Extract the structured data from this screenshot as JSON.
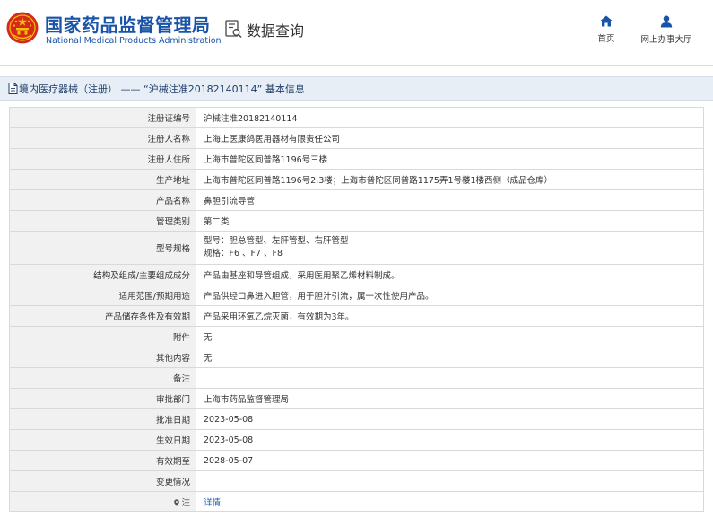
{
  "header": {
    "agency_cn": "国家药品监督管理局",
    "agency_en": "National Medical Products Administration",
    "query_title": "数据查询",
    "nav": [
      {
        "label": "首页",
        "icon": "home-icon"
      },
      {
        "label": "网上办事大厅",
        "icon": "user-icon"
      }
    ]
  },
  "title_bar": {
    "text": "境内医疗器械（注册） —— “沪械注准20182140114” 基本信息",
    "icon": "document-icon"
  },
  "record": {
    "reg_no": {
      "label": "注册证编号",
      "value": "沪械注准20182140114"
    },
    "registrant": {
      "label": "注册人名称",
      "value": "上海上医康鸽医用器材有限责任公司"
    },
    "address": {
      "label": "注册人住所",
      "value": "上海市普陀区同普路1196号三楼"
    },
    "production_address": {
      "label": "生产地址",
      "value": "上海市普陀区同普路1196号2,3楼；上海市普陀区同普路1175弄1号楼1楼西侧（成品仓库）"
    },
    "product_name": {
      "label": "产品名称",
      "value": "鼻胆引流导管"
    },
    "category": {
      "label": "管理类别",
      "value": "第二类"
    },
    "model_spec": {
      "label": "型号规格",
      "line1": "型号：胆总管型、左肝管型、右肝管型",
      "line2": "规格：F6 、F7 、F8"
    },
    "structure": {
      "label": "结构及组成/主要组成成分",
      "value": "产品由基座和导管组成，采用医用聚乙烯材料制成。"
    },
    "scope": {
      "label": "适用范围/预期用途",
      "value": "产品供经口鼻进入胆管，用于胆汁引流，属一次性使用产品。"
    },
    "storage": {
      "label": "产品储存条件及有效期",
      "value": "产品采用环氧乙烷灭菌，有效期为3年。"
    },
    "attachment": {
      "label": "附件",
      "value": "无"
    },
    "other": {
      "label": "其他内容",
      "value": "无"
    },
    "remarks": {
      "label": "备注",
      "value": ""
    },
    "approval_dept": {
      "label": "审批部门",
      "value": "上海市药品监督管理局"
    },
    "approval_date": {
      "label": "批准日期",
      "value": "2023-05-08"
    },
    "effective_date": {
      "label": "生效日期",
      "value": "2023-05-08"
    },
    "expiry_date": {
      "label": "有效期至",
      "value": "2028-05-07"
    },
    "changes": {
      "label": "变更情况",
      "value": ""
    },
    "note": {
      "label": "注",
      "link": "详情"
    }
  },
  "colors": {
    "brand_blue": "#1a54a8",
    "title_bar_bg": "#e7eef5",
    "label_bg": "#f1f1f1",
    "border": "#d9d9d9",
    "emblem_red": "#d7281d",
    "emblem_gold": "#f2c200",
    "link": "#1a5fb4"
  }
}
